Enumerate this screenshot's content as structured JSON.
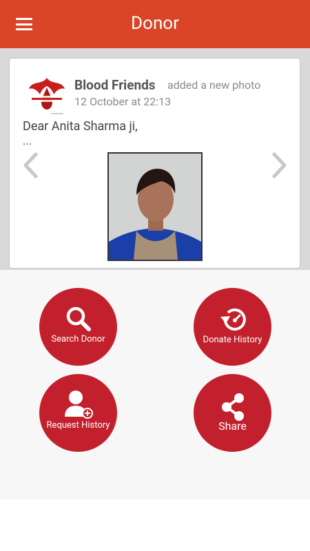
{
  "appbar": {
    "title": "Donor"
  },
  "post": {
    "author": "Blood Friends",
    "action": "added a new photo",
    "timestamp": "12 October at 22:13",
    "text": "Dear Anita Sharma ji,",
    "ellipsis": "..."
  },
  "buttons": {
    "search_donor": "Search Donor",
    "donate_history": "Donate History",
    "request_history": "Request History",
    "share": "Share"
  },
  "colors": {
    "appbar": "#DA4527",
    "button": "#C3202D",
    "feed_background": "#D9D9D9"
  },
  "icons": {
    "menu": "menu-icon",
    "search": "search-icon",
    "history": "history-icon",
    "add_user": "user-add-icon",
    "share": "share-icon"
  }
}
